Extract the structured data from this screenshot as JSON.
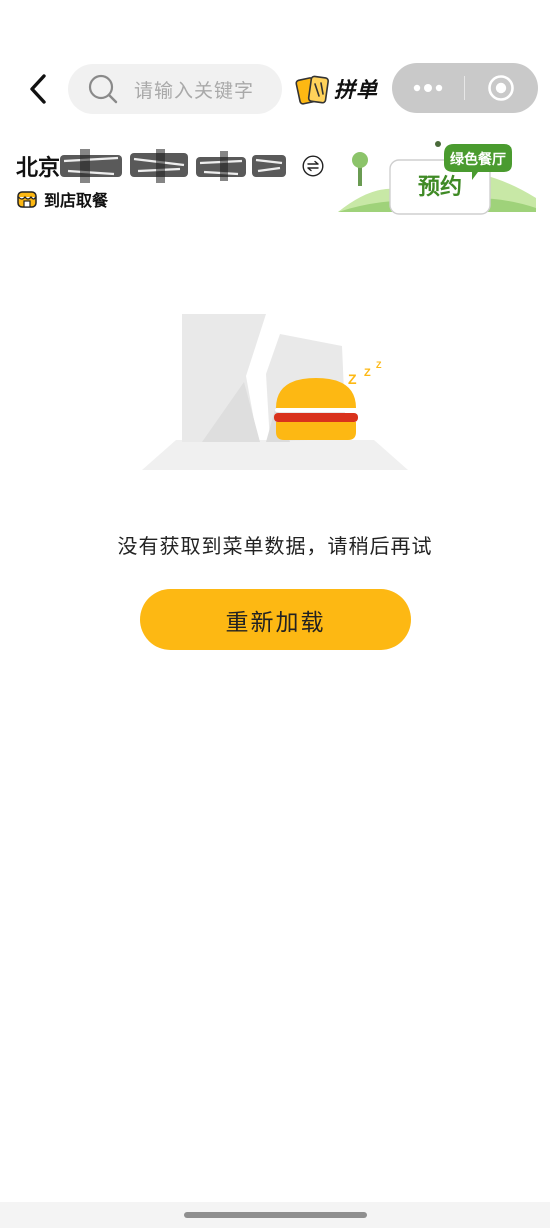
{
  "search": {
    "placeholder": "请输入关键字"
  },
  "pindan": {
    "label": "拼单"
  },
  "store": {
    "name": "北京",
    "mode_label": "到店取餐"
  },
  "banner": {
    "tag": "绿色餐厅",
    "label": "预约"
  },
  "empty_state": {
    "message": "没有获取到菜单数据，请稍后再试",
    "reload_label": "重新加载"
  },
  "colors": {
    "accent_yellow": "#fdb813",
    "banner_green": "#4a9b2f",
    "capsule_gray": "#c9c9c9"
  }
}
